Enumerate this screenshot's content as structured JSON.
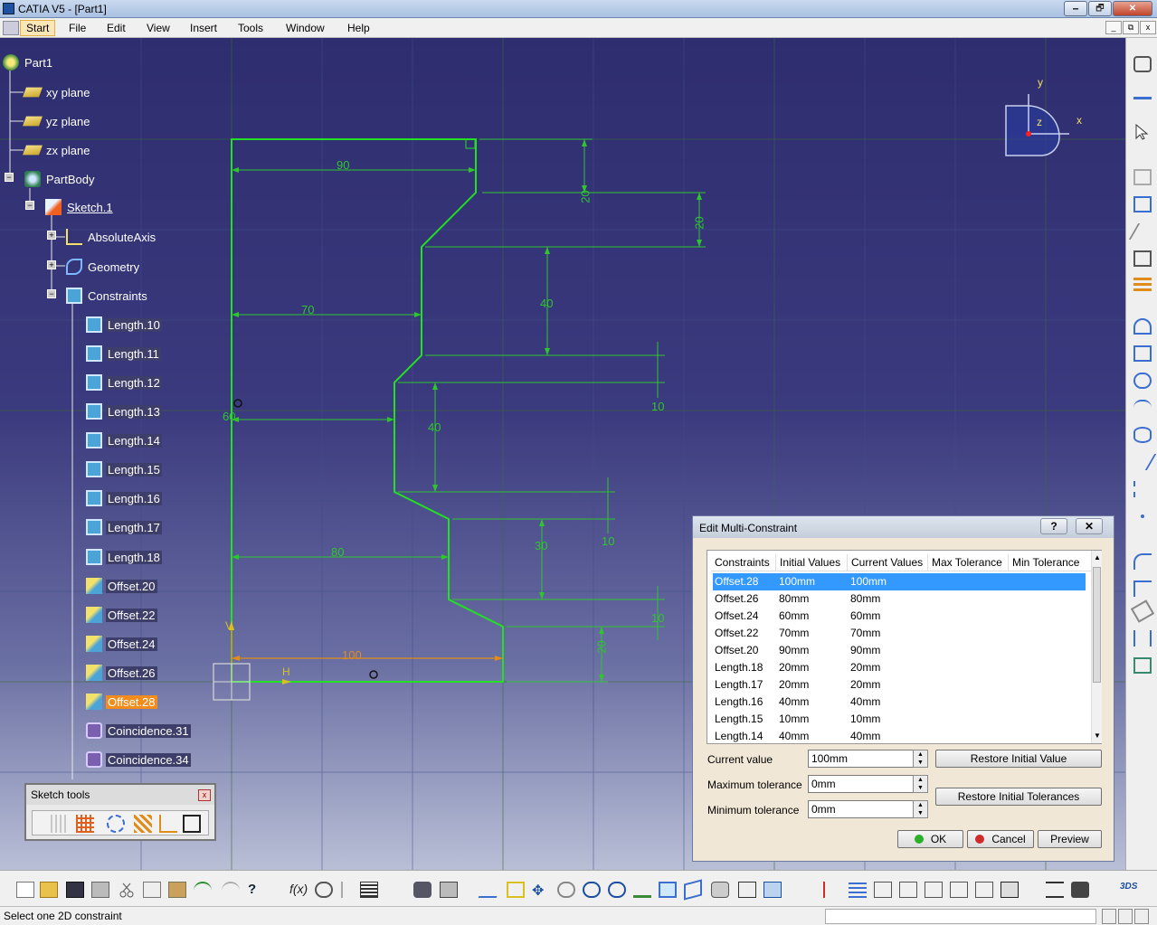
{
  "window": {
    "title": "CATIA V5 - [Part1]",
    "minimize": "🗕",
    "maximize": "🗗",
    "close": "✕"
  },
  "menu": {
    "items": [
      "Start",
      "File",
      "Edit",
      "View",
      "Insert",
      "Tools",
      "Window",
      "Help"
    ],
    "mdi_buttons": [
      "_",
      "⧉",
      "x"
    ]
  },
  "tree": {
    "nodes": [
      {
        "label": "Part1",
        "icon": "part-icon"
      },
      {
        "label": "xy plane",
        "icon": "plane-icon"
      },
      {
        "label": "yz plane",
        "icon": "plane-icon"
      },
      {
        "label": "zx plane",
        "icon": "plane-icon"
      },
      {
        "label": "PartBody",
        "icon": "partbody-icon"
      },
      {
        "label": "Sketch.1",
        "icon": "sketch-icon"
      },
      {
        "label": "AbsoluteAxis",
        "icon": "axis-icon"
      },
      {
        "label": "Geometry",
        "icon": "geometry-icon"
      },
      {
        "label": "Constraints",
        "icon": "constraints-icon"
      },
      {
        "label": "Length.10",
        "icon": "length-constraint-icon"
      },
      {
        "label": "Length.11",
        "icon": "length-constraint-icon"
      },
      {
        "label": "Length.12",
        "icon": "length-constraint-icon"
      },
      {
        "label": "Length.13",
        "icon": "length-constraint-icon"
      },
      {
        "label": "Length.14",
        "icon": "length-constraint-icon"
      },
      {
        "label": "Length.15",
        "icon": "length-constraint-icon"
      },
      {
        "label": "Length.16",
        "icon": "length-constraint-icon"
      },
      {
        "label": "Length.17",
        "icon": "length-constraint-icon"
      },
      {
        "label": "Length.18",
        "icon": "length-constraint-icon"
      },
      {
        "label": "Offset.20",
        "icon": "offset-constraint-icon"
      },
      {
        "label": "Offset.22",
        "icon": "offset-constraint-icon"
      },
      {
        "label": "Offset.24",
        "icon": "offset-constraint-icon"
      },
      {
        "label": "Offset.26",
        "icon": "offset-constraint-icon"
      },
      {
        "label": "Offset.28",
        "icon": "offset-constraint-icon",
        "selected": true
      },
      {
        "label": "Coincidence.31",
        "icon": "coincidence-icon"
      },
      {
        "label": "Coincidence.34",
        "icon": "coincidence-icon"
      }
    ]
  },
  "sketch": {
    "dims": {
      "d90": "90",
      "d20a": "20",
      "d20b": "20",
      "d70": "70",
      "d40a": "40",
      "d10a": "10",
      "d60": "60",
      "d40b": "40",
      "d10b": "10",
      "d80": "80",
      "d30": "30",
      "d10c": "10",
      "d100": "100",
      "d20c": "20"
    },
    "axis_h": "H",
    "axis_v": "V",
    "compass": {
      "x": "x",
      "y": "y",
      "z": "z"
    }
  },
  "sketch_tools": {
    "title": "Sketch tools",
    "close": "x"
  },
  "dialog": {
    "title": "Edit Multi-Constraint",
    "help_btn": "?",
    "close_btn": "✕",
    "columns": [
      "Constraints",
      "Initial Values",
      "Current Values",
      "Max Tolerance",
      "Min Tolerance"
    ],
    "rows": [
      {
        "name": "Offset.28",
        "initial": "100mm",
        "current": "100mm",
        "selected": true
      },
      {
        "name": "Offset.26",
        "initial": "80mm",
        "current": "80mm"
      },
      {
        "name": "Offset.24",
        "initial": "60mm",
        "current": "60mm"
      },
      {
        "name": "Offset.22",
        "initial": "70mm",
        "current": "70mm"
      },
      {
        "name": "Offset.20",
        "initial": "90mm",
        "current": "90mm"
      },
      {
        "name": "Length.18",
        "initial": "20mm",
        "current": "20mm"
      },
      {
        "name": "Length.17",
        "initial": "20mm",
        "current": "20mm"
      },
      {
        "name": "Length.16",
        "initial": "40mm",
        "current": "40mm"
      },
      {
        "name": "Length.15",
        "initial": "10mm",
        "current": "10mm"
      },
      {
        "name": "Length.14",
        "initial": "40mm",
        "current": "40mm"
      }
    ],
    "current_value_label": "Current value",
    "current_value": "100mm",
    "max_tol_label": "Maximum tolerance",
    "max_tol": "0mm",
    "min_tol_label": "Minimum tolerance",
    "min_tol": "0mm",
    "restore_initial_value": "Restore Initial Value",
    "restore_initial_tolerances": "Restore Initial Tolerances",
    "ok": "OK",
    "cancel": "Cancel",
    "preview": "Preview"
  },
  "status": {
    "message": "Select one 2D constraint"
  },
  "colors": {
    "geometry": "#22e022",
    "dimension": "#2fc52f",
    "selected_dimension": "#e08c1a",
    "tree_selection": "#f28c1c",
    "dialog_selection": "#3399ff"
  }
}
